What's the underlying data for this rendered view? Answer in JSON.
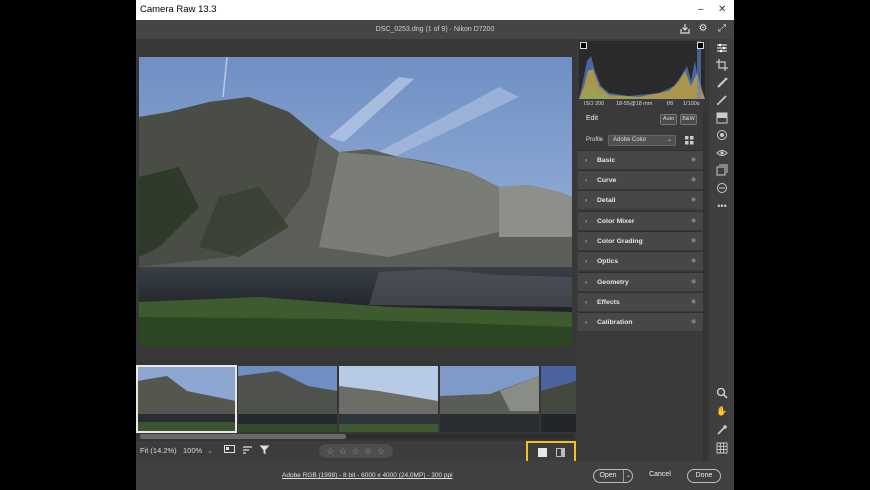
{
  "window": {
    "title": "Camera Raw 13.3"
  },
  "header": {
    "file_info": "DSC_0253.dng (1 of 9)  ·  Nikon D7200",
    "save_icon": "save-icon",
    "settings_icon": "gear-icon",
    "fullscreen_icon": "fullscreen-icon"
  },
  "viewbar": {
    "zoom_fit": "Fit (14.2%)",
    "zoom_level": "100%",
    "stars": "☆ ☆ ☆ ☆ ☆",
    "flag_icon": "flag-icon"
  },
  "bottom": {
    "workflow_link": "Adobe RGB (1998) - 8 bit - 6000 x 4000 (24.0MP) - 300 ppi",
    "open_label": "Open",
    "cancel_label": "Cancel",
    "done_label": "Done"
  },
  "exif": {
    "iso": "ISO 200",
    "lens": "18-55@18 mm",
    "aperture": "f/8",
    "shutter": "1/100s"
  },
  "edit": {
    "title": "Edit",
    "auto_label": "Auto",
    "bw_label": "B&W",
    "profile_label": "Profile",
    "profile_value": "Adobe Color"
  },
  "sections": [
    {
      "label": "Basic"
    },
    {
      "label": "Curve"
    },
    {
      "label": "Detail"
    },
    {
      "label": "Color Mixer"
    },
    {
      "label": "Color Grading"
    },
    {
      "label": "Optics"
    },
    {
      "label": "Geometry"
    },
    {
      "label": "Effects"
    },
    {
      "label": "Calibration"
    }
  ],
  "colors": {
    "accent_highlight": "#f3c01c",
    "panel_bg": "#3a3a3a",
    "canvas_bg": "#383838"
  }
}
